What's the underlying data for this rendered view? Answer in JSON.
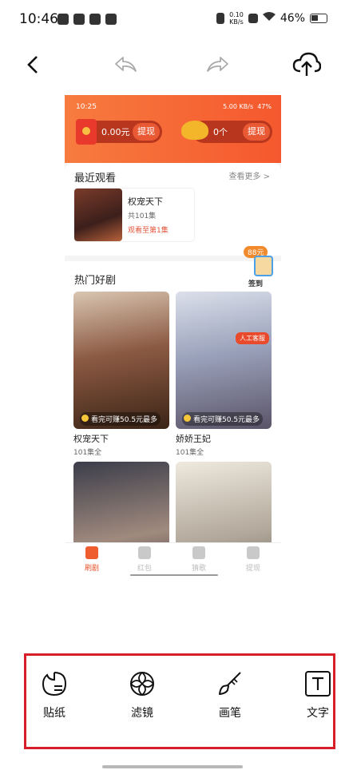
{
  "status_bar": {
    "time": "10:46",
    "net_speed_value": "0.10",
    "net_speed_unit": "KB/s",
    "battery": "46%"
  },
  "preview": {
    "status_time": "10:25",
    "status_battery": "47%",
    "status_speed": "5.00 KB/s",
    "wallet": {
      "cash": "0.00元",
      "cash_button": "提现",
      "coins": "0个",
      "coins_button": "提现"
    },
    "recent": {
      "title": "最近观看",
      "see_more": "查看更多 >",
      "item": {
        "title": "权宠天下",
        "episodes": "共101集",
        "progress": "观看至第1集"
      }
    },
    "hot": {
      "title": "热门好剧",
      "signin_badge": "88元",
      "signin_label": "签到",
      "service_label": "人工客服",
      "items": [
        {
          "title": "权宠天下",
          "sub": "101集全",
          "earn": "看完可赚50.5元最多"
        },
        {
          "title": "娇娇王妃",
          "sub": "101集全",
          "earn": "看完可赚50.5元最多"
        },
        {
          "title": "",
          "sub": "",
          "earn": ""
        },
        {
          "title": "",
          "sub": "",
          "earn": ""
        }
      ]
    },
    "nav": [
      {
        "label": "刷剧",
        "active": true
      },
      {
        "label": "红包",
        "active": false
      },
      {
        "label": "猜歌",
        "active": false
      },
      {
        "label": "提现",
        "active": false
      }
    ]
  },
  "toolbar": {
    "back_icon": "back-arrow-icon",
    "undo_icon": "undo-icon",
    "redo_icon": "redo-icon",
    "upload_icon": "cloud-upload-icon"
  },
  "tools": [
    {
      "label": "贴纸",
      "icon": "sticker-icon"
    },
    {
      "label": "滤镜",
      "icon": "filter-icon"
    },
    {
      "label": "画笔",
      "icon": "brush-icon"
    },
    {
      "label": "文字",
      "icon": "text-icon"
    }
  ],
  "colors": {
    "accent": "#f5582e",
    "highlight_frame": "#d81e28"
  }
}
